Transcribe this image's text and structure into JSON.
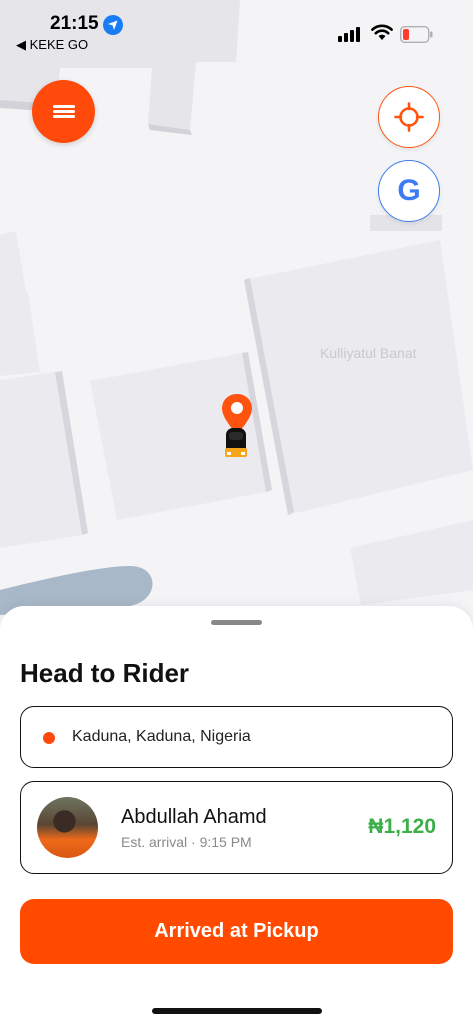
{
  "status_bar": {
    "time": "21:15",
    "back_app": "◀ KEKE GO"
  },
  "map": {
    "place_label": "Kulliyatul Banat"
  },
  "map_controls": {
    "google_label": "G"
  },
  "sheet": {
    "title": "Head to Rider",
    "destination": "Kaduna, Kaduna, Nigeria",
    "rider": {
      "name": "Abdullah Ahamd",
      "eta": "Est. arrival · 9:15 PM",
      "fare": "₦1,120"
    },
    "action_label": "Arrived at Pickup"
  },
  "colors": {
    "accent": "#ff4a00",
    "fare_green": "#3cae4a",
    "google_blue": "#3d7cf0"
  }
}
